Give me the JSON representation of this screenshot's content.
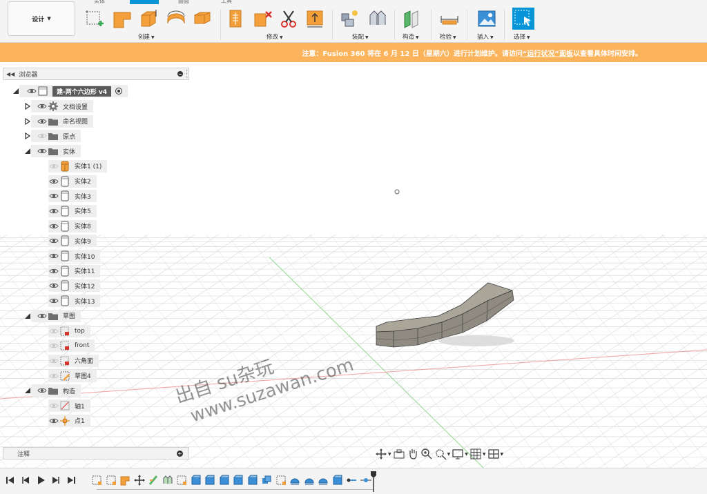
{
  "toolbar": {
    "workspace_label": "设计",
    "tabs": [
      "实体",
      "",
      "曲面",
      "工具"
    ],
    "groups": {
      "create": "创建",
      "modify": "修改",
      "assemble": "装配",
      "construct": "构造",
      "inspect": "检验",
      "insert": "插入",
      "select": "选择"
    }
  },
  "banner": {
    "prefix": "注意：Fusion 360 将在 6 月 12 日（星期六）进行计划维护。请访问",
    "link": "“运行状况”面板",
    "suffix": "以查看具体时间安排。"
  },
  "browser": {
    "title": "浏览器",
    "root": "建-两个六边形 v4",
    "items": [
      {
        "label": "文档设置",
        "icon": "gear-icon"
      },
      {
        "label": "命名视图",
        "icon": "folder-icon"
      },
      {
        "label": "原点",
        "icon": "folder-icon"
      },
      {
        "label": "实体",
        "icon": "folder-icon"
      },
      {
        "label": "实体1 (1)",
        "icon": "body-orange-icon"
      },
      {
        "label": "实体2",
        "icon": "body-icon"
      },
      {
        "label": "实体3",
        "icon": "body-icon"
      },
      {
        "label": "实体5",
        "icon": "body-icon"
      },
      {
        "label": "实体8",
        "icon": "body-icon"
      },
      {
        "label": "实体9",
        "icon": "body-icon"
      },
      {
        "label": "实体10",
        "icon": "body-icon"
      },
      {
        "label": "实体11",
        "icon": "body-icon"
      },
      {
        "label": "实体12",
        "icon": "body-icon"
      },
      {
        "label": "实体13",
        "icon": "body-icon"
      },
      {
        "label": "草图",
        "icon": "folder-icon"
      },
      {
        "label": "top",
        "icon": "sketch-icon"
      },
      {
        "label": "front",
        "icon": "sketch-icon"
      },
      {
        "label": "六角面",
        "icon": "sketch-icon"
      },
      {
        "label": "草图4",
        "icon": "sketch-edit-icon"
      },
      {
        "label": "构造",
        "icon": "folder-icon"
      },
      {
        "label": "轴1",
        "icon": "axis-icon"
      },
      {
        "label": "点1",
        "icon": "point-icon"
      }
    ]
  },
  "comments": {
    "title": "注释"
  },
  "watermark": {
    "line1": "出自 su杂玩",
    "line2": "www.suzawan.com"
  },
  "colors": {
    "accent": "#0696d7",
    "banner": "#fbb35c",
    "sketch_red": "#d9342b",
    "body_orange": "#f3a03c"
  }
}
